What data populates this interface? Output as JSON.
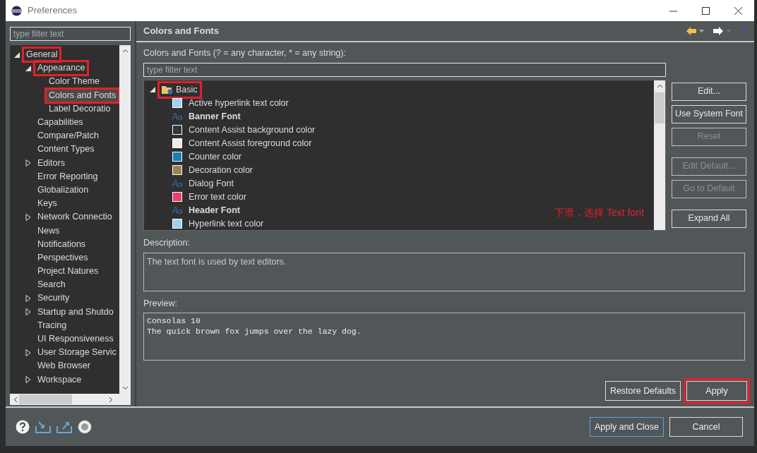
{
  "window": {
    "title": "Preferences"
  },
  "filter": {
    "placeholder": "type filter text"
  },
  "nav_tree": [
    {
      "label": "General",
      "expanded": true,
      "highlighted": true,
      "selected": false,
      "children": [
        {
          "label": "Appearance",
          "expanded": true,
          "highlighted": true,
          "selected": false,
          "children": [
            {
              "label": "Color Theme",
              "highlighted": false,
              "selected": false
            },
            {
              "label": "Colors and Fonts",
              "highlighted": true,
              "selected": true
            },
            {
              "label": "Label Decoratio",
              "highlighted": false,
              "selected": false
            }
          ]
        },
        {
          "label": "Capabilities",
          "highlighted": false,
          "selected": false
        },
        {
          "label": "Compare/Patch",
          "highlighted": false,
          "selected": false
        },
        {
          "label": "Content Types",
          "highlighted": false,
          "selected": false
        },
        {
          "label": "Editors",
          "expanded": false,
          "highlighted": false,
          "selected": false
        },
        {
          "label": "Error Reporting",
          "highlighted": false,
          "selected": false
        },
        {
          "label": "Globalization",
          "highlighted": false,
          "selected": false
        },
        {
          "label": "Keys",
          "highlighted": false,
          "selected": false
        },
        {
          "label": "Network Connectio",
          "expanded": false,
          "highlighted": false,
          "selected": false
        },
        {
          "label": "News",
          "highlighted": false,
          "selected": false
        },
        {
          "label": "Notifications",
          "highlighted": false,
          "selected": false
        },
        {
          "label": "Perspectives",
          "highlighted": false,
          "selected": false
        },
        {
          "label": "Project Natures",
          "highlighted": false,
          "selected": false
        },
        {
          "label": "Search",
          "highlighted": false,
          "selected": false
        },
        {
          "label": "Security",
          "expanded": false,
          "highlighted": false,
          "selected": false
        },
        {
          "label": "Startup and Shutdo",
          "expanded": false,
          "highlighted": false,
          "selected": false
        },
        {
          "label": "Tracing",
          "highlighted": false,
          "selected": false
        },
        {
          "label": "UI Responsiveness",
          "highlighted": false,
          "selected": false
        },
        {
          "label": "User Storage Servic",
          "expanded": false,
          "highlighted": false,
          "selected": false
        },
        {
          "label": "Web Browser",
          "highlighted": false,
          "selected": false
        },
        {
          "label": "Workspace",
          "expanded": false,
          "highlighted": false,
          "selected": false
        }
      ]
    }
  ],
  "page": {
    "title": "Colors and Fonts",
    "filter_label": "Colors and Fonts (? = any character, * = any string):",
    "filter": {
      "placeholder": "type filter text"
    },
    "tree": [
      {
        "label": "Basic",
        "expanded": true,
        "highlighted": true,
        "children": [
          {
            "kind": "color",
            "label": "Active hyperlink text color",
            "color": "#9fd0f0"
          },
          {
            "kind": "font",
            "label": "Banner Font",
            "bold": true
          },
          {
            "kind": "color",
            "label": "Content Assist background color",
            "color": "#34353a"
          },
          {
            "kind": "color",
            "label": "Content Assist foreground color",
            "color": "#ececec"
          },
          {
            "kind": "color",
            "label": "Counter color",
            "color": "#1a80b6"
          },
          {
            "kind": "color",
            "label": "Decoration color",
            "color": "#9a8550"
          },
          {
            "kind": "font",
            "label": "Dialog Font",
            "bold": false
          },
          {
            "kind": "color",
            "label": "Error text color",
            "color": "#e8406a"
          },
          {
            "kind": "font",
            "label": "Header Font",
            "bold": true
          },
          {
            "kind": "color",
            "label": "Hyperlink text color",
            "color": "#9fd0f0"
          }
        ]
      }
    ],
    "side_buttons": [
      {
        "label": "Edit...",
        "disabled": false
      },
      {
        "label": "Use System Font",
        "disabled": false
      },
      {
        "label": "Reset",
        "disabled": true
      },
      {
        "label": "Edit Default...",
        "disabled": true
      },
      {
        "label": "Go to Default",
        "disabled": true
      },
      {
        "label": "Expand All",
        "disabled": false
      }
    ],
    "annotation": "下滑，选择 Text font",
    "description_label": "Description:",
    "description": "The text font is used by text editors.",
    "preview_label": "Preview:",
    "preview": [
      "Consolas 10",
      "The quick brown fox jumps over the lazy dog."
    ],
    "buttons": [
      {
        "label": "Restore Defaults",
        "highlighted": false
      },
      {
        "label": "Apply",
        "highlighted": true
      }
    ]
  },
  "footer_buttons": [
    {
      "label": "Apply and Close",
      "default": true
    },
    {
      "label": "Cancel",
      "default": false
    }
  ]
}
